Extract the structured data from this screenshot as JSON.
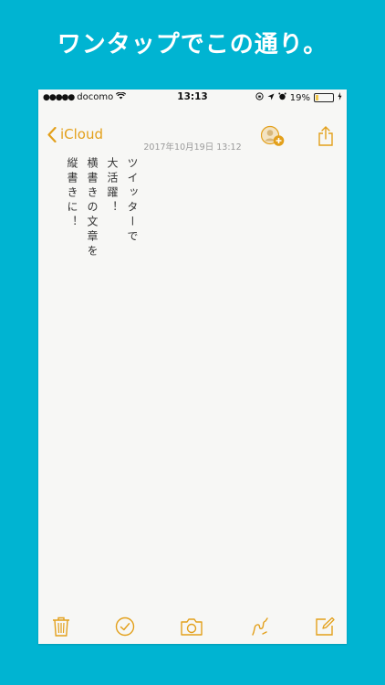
{
  "headline": "ワンタップでこの通り。",
  "status": {
    "signal_dots": "●●●●●",
    "carrier": "docomo",
    "time": "13:13",
    "battery_percent": "19%",
    "battery_level": 0.19
  },
  "nav": {
    "back_label": "iCloud"
  },
  "note": {
    "date": "2017年10月19日 13:12",
    "lines": [
      "ツイッターで",
      "大活躍！",
      "横書きの文章を",
      "縦書きに！"
    ]
  },
  "colors": {
    "accent": "#e3a01b",
    "background": "#00b4d2",
    "paper": "#f7f7f5"
  },
  "icons": {
    "toolbar": [
      "trash-icon",
      "checkmark-icon",
      "camera-icon",
      "sketch-icon",
      "compose-icon"
    ],
    "nav": [
      "add-person-icon",
      "share-icon"
    ]
  }
}
